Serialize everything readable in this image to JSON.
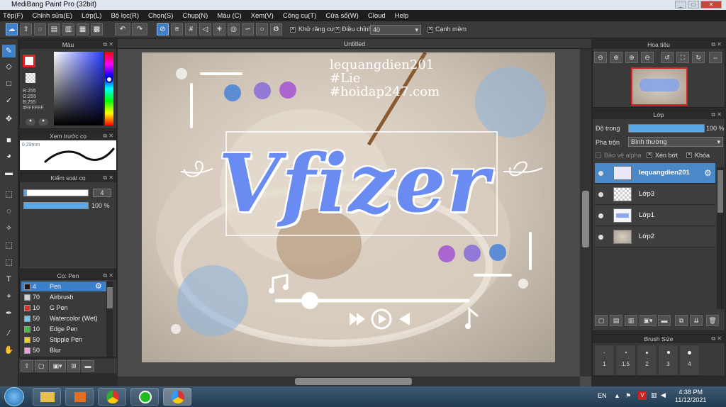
{
  "window": {
    "title": "MediBang Paint Pro (32bit)"
  },
  "menu": [
    "Tệp(F)",
    "Chỉnh sửa(E)",
    "Lớp(L)",
    "Bộ lọc(R)",
    "Chọn(S)",
    "Chụp(N)",
    "Màu (C)",
    "Xem(V)",
    "Công cụ(T)",
    "Cửa sổ(W)",
    "Cloud",
    "Help"
  ],
  "toolbar": {
    "antialias_label": "Khử răng cưa",
    "adjust_label": "Điều chỉnh",
    "adjust_value": "40",
    "sharp_label": "Cạnh mềm"
  },
  "color_panel": {
    "title": "Màu",
    "r": "R:255",
    "g": "G:255",
    "b": "B:255",
    "hex": "#FFFFFF"
  },
  "preview_panel": {
    "title": "Xem trước cọ",
    "size": "0.29mm"
  },
  "control_panel": {
    "title": "Kiểm soát cọ",
    "size_value": "4",
    "opacity_value": "100 %"
  },
  "brush_panel": {
    "title": "Cọ: Pen",
    "items": [
      {
        "size": "4",
        "name": "Pen",
        "color": "#1a1a1a"
      },
      {
        "size": "70",
        "name": "Airbrush",
        "color": "#d0d0d0"
      },
      {
        "size": "10",
        "name": "G Pen",
        "color": "#e03030"
      },
      {
        "size": "50",
        "name": "Watercolor (Wet)",
        "color": "#70c8f0"
      },
      {
        "size": "10",
        "name": "Edge Pen",
        "color": "#40c040"
      },
      {
        "size": "50",
        "name": "Stipple Pen",
        "color": "#f0d020"
      },
      {
        "size": "50",
        "name": "Blur",
        "color": "#f0a0e0"
      }
    ]
  },
  "canvas": {
    "tab_title": "Untitled"
  },
  "artwork": {
    "line1": "lequangdien201",
    "line2": "#Lie",
    "line3": "#hoidap247.com",
    "big_text": "Vfizer"
  },
  "navigator": {
    "title": "Hoa tiêu"
  },
  "layer_panel": {
    "title": "Lớp",
    "opacity_label": "Độ trong",
    "opacity_value": "100 %",
    "opacity": 1.0,
    "blend_label": "Pha trộn",
    "blend_value": "Bình thường",
    "protect_alpha": "Bảo vệ alpha",
    "clip": "Xén bớt",
    "lock": "Khóa",
    "layers": [
      "lequangdien201",
      "Lớp3",
      "Lớp1",
      "Lớp2"
    ]
  },
  "brush_size_panel": {
    "title": "Brush Size",
    "sizes": [
      "1",
      "1.5",
      "2",
      "3",
      "4"
    ]
  },
  "taskbar": {
    "lang": "EN",
    "time": "4:38 PM",
    "date": "11/12/2021"
  }
}
